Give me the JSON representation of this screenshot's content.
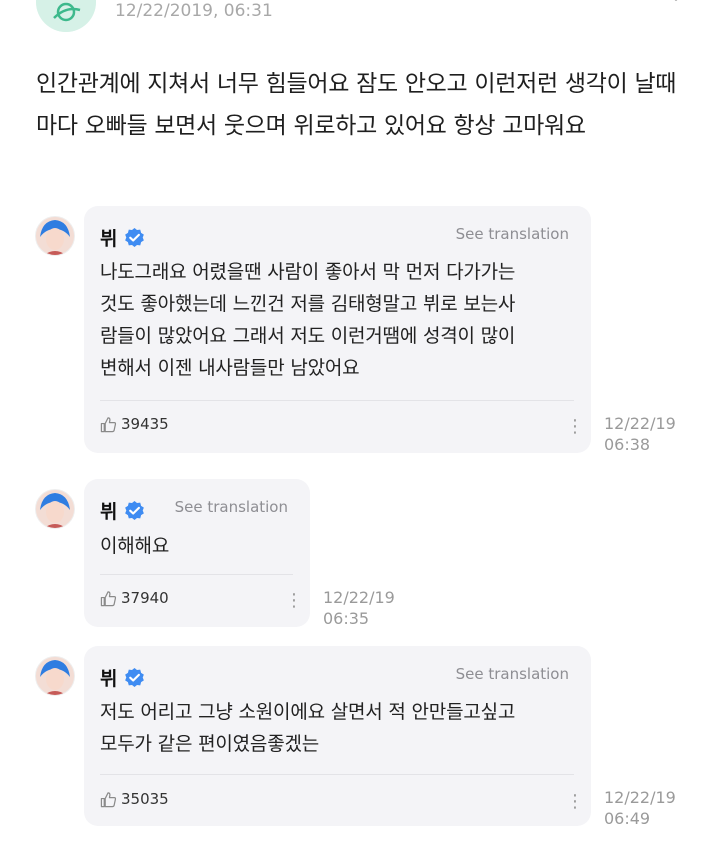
{
  "post": {
    "timestamp": "12/22/2019, 06:31",
    "text": "인간관계에 지쳐서 너무 힘들어요 잠도 안오고 이런저런 생각이 날때마다 오빠들 보면서 웃으며 위로하고 있어요 항상 고마워요"
  },
  "replies": [
    {
      "author": "뷔",
      "translate_label": "See translation",
      "lines": [
        "나도그래요 어렸을땐 사람이 좋아서 막 먼저 다가가는",
        "것도 좋아했는데 느낀건 저를 김태형말고 뷔로 보는사",
        "람들이 많았어요 그래서 저도 이런거땜에 성격이 많이",
        "변해서 이젠 내사람들만 남았어요"
      ],
      "likes": "39435",
      "time_date": "12/22/19",
      "time_clock": "06:38"
    },
    {
      "author": "뷔",
      "translate_label": "See translation",
      "lines": [
        "이해해요"
      ],
      "likes": "37940",
      "time_date": "12/22/19",
      "time_clock": "06:35"
    },
    {
      "author": "뷔",
      "translate_label": "See translation",
      "lines": [
        "저도 어리고 그냥 소원이에요 살면서 적 안만들고싶고",
        "모두가 같은 편이였음좋겠는"
      ],
      "likes": "35035",
      "time_date": "12/22/19",
      "time_clock": "06:49"
    }
  ],
  "icons": {
    "verified": "verified-badge-icon",
    "like": "thumbs-up-icon",
    "more": "more-vertical-icon"
  },
  "colors": {
    "verified": "#3f8cf2",
    "bubble": "#f4f4f7",
    "muted_text": "#9a9a9a",
    "avatar_hair": "#2f7de1"
  }
}
